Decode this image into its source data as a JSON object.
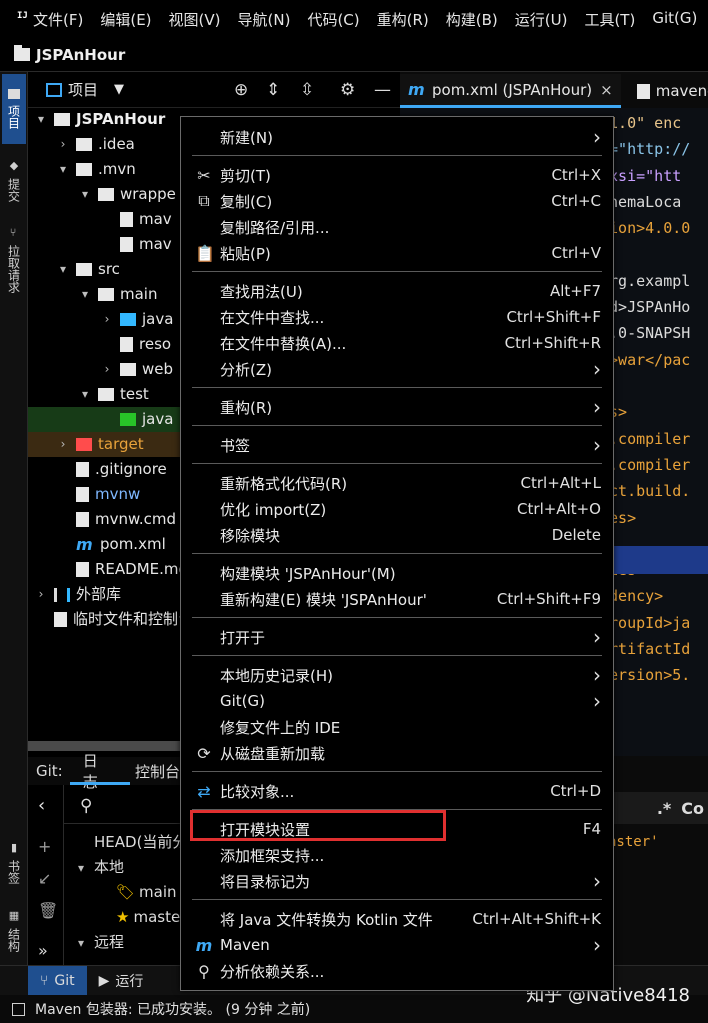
{
  "menubar": {
    "items": [
      "文件(F)",
      "编辑(E)",
      "视图(V)",
      "导航(N)",
      "代码(C)",
      "重构(R)",
      "构建(B)",
      "运行(U)",
      "工具(T)",
      "Git(G)",
      "窗"
    ]
  },
  "titlebar": {
    "project": "JSPAnHour"
  },
  "left_stripe": {
    "tabs": [
      "项目",
      "提交",
      "拉取请求",
      "书签",
      "结构"
    ]
  },
  "project_panel": {
    "title": "项目",
    "tree": [
      {
        "label": "JSPAnHour",
        "depth": 0,
        "arrow": "▾",
        "icon": "project",
        "color": "#f0f0f0",
        "bold": true
      },
      {
        "label": ".idea",
        "depth": 1,
        "arrow": "›",
        "icon": "folder",
        "color": "#e6e6e6"
      },
      {
        "label": ".mvn",
        "depth": 1,
        "arrow": "▾",
        "icon": "folder",
        "color": "#e6e6e6"
      },
      {
        "label": "wrappe",
        "depth": 2,
        "arrow": "▾",
        "icon": "folder",
        "color": "#e6e6e6"
      },
      {
        "label": "mav",
        "depth": 3,
        "arrow": "",
        "icon": "file",
        "color": "#e6e6e6"
      },
      {
        "label": "mav",
        "depth": 3,
        "arrow": "",
        "icon": "file",
        "color": "#e6e6e6"
      },
      {
        "label": "src",
        "depth": 1,
        "arrow": "▾",
        "icon": "folder",
        "color": "#e6e6e6"
      },
      {
        "label": "main",
        "depth": 2,
        "arrow": "▾",
        "icon": "folder",
        "color": "#e6e6e6"
      },
      {
        "label": "java",
        "depth": 3,
        "arrow": "›",
        "icon": "folder-blue",
        "color": "#e6e6e6"
      },
      {
        "label": "reso",
        "depth": 3,
        "arrow": "",
        "icon": "file",
        "color": "#e6e6e6"
      },
      {
        "label": "web",
        "depth": 3,
        "arrow": "›",
        "icon": "folder",
        "color": "#e6e6e6"
      },
      {
        "label": "test",
        "depth": 2,
        "arrow": "▾",
        "icon": "folder",
        "color": "#e6e6e6"
      },
      {
        "label": "java",
        "depth": 3,
        "arrow": "",
        "icon": "folder-green",
        "color": "#e6e6e6",
        "hl": "green"
      },
      {
        "label": "target",
        "depth": 1,
        "arrow": "›",
        "icon": "folder-red",
        "color": "#e8a23a",
        "hl": "brown"
      },
      {
        "label": ".gitignore",
        "depth": 1,
        "arrow": "",
        "icon": "file",
        "color": "#e6e6e6"
      },
      {
        "label": "mvnw",
        "depth": 1,
        "arrow": "",
        "icon": "file",
        "color": "#7fb8ff"
      },
      {
        "label": "mvnw.cmd",
        "depth": 1,
        "arrow": "",
        "icon": "file",
        "color": "#e6e6e6"
      },
      {
        "label": "pom.xml",
        "depth": 1,
        "arrow": "",
        "icon": "m",
        "color": "#e6e6e6"
      },
      {
        "label": "README.md",
        "depth": 1,
        "arrow": "",
        "icon": "file",
        "color": "#e6e6e6"
      },
      {
        "label": "外部库",
        "depth": 0,
        "arrow": "›",
        "icon": "lib",
        "color": "#e6e6e6"
      },
      {
        "label": "临时文件和控制台",
        "depth": 0,
        "arrow": "",
        "icon": "file",
        "color": "#e6e6e6"
      }
    ]
  },
  "git_panel": {
    "label": "Git:",
    "tabs": [
      "日志",
      "控制台"
    ],
    "rows": [
      {
        "label": "HEAD(当前分支)",
        "depth": 0,
        "arrow": ""
      },
      {
        "label": "本地",
        "depth": 0,
        "arrow": "▾"
      },
      {
        "label": "main",
        "depth": 1,
        "arrow": "",
        "icon": "🏷"
      },
      {
        "label": "master",
        "depth": 1,
        "arrow": "",
        "icon": "★"
      },
      {
        "label": "远程",
        "depth": 0,
        "arrow": "▾"
      }
    ]
  },
  "bottom_stripe": {
    "tabs": [
      "Git",
      "运行"
    ]
  },
  "statusbar": {
    "text": "Maven 包装器: 已成功安装。 (9 分钟 之前)",
    "watermark": "知乎 @Native8418"
  },
  "editor": {
    "tabs": [
      {
        "label": "pom.xml (JSPAnHour)",
        "close": "×"
      },
      {
        "label": "maven-"
      }
    ],
    "lines": [
      "'1.0\" enc",
      "s=\"http://",
      ":xsi=\"htt",
      "chemaLoca",
      "sion>4.0.0",
      "",
      "org.exampl",
      "Id>JSPAnHo",
      "1.0-SNAPSH",
      "g>war</pac",
      "",
      "es>",
      "n.compiler",
      "n.compiler",
      "ect.build.",
      "ies>",
      "",
      "cies>",
      "ndency>",
      "groupId>ja",
      "artifactId",
      "version>5."
    ],
    "bottom_text": "aster'",
    "bottom_text2": "ncies",
    "find_label": "Co"
  },
  "context_menu": {
    "groups": [
      [
        {
          "label": "新建(N)",
          "submenu": true
        }
      ],
      [
        {
          "icon": "✂",
          "label": "剪切(T)",
          "shortcut": "Ctrl+X"
        },
        {
          "icon": "⧉",
          "label": "复制(C)",
          "shortcut": "Ctrl+C"
        },
        {
          "label": "复制路径/引用..."
        },
        {
          "icon": "📋",
          "label": "粘贴(P)",
          "shortcut": "Ctrl+V"
        }
      ],
      [
        {
          "label": "查找用法(U)",
          "shortcut": "Alt+F7"
        },
        {
          "label": "在文件中查找...",
          "shortcut": "Ctrl+Shift+F"
        },
        {
          "label": "在文件中替换(A)...",
          "shortcut": "Ctrl+Shift+R"
        },
        {
          "label": "分析(Z)",
          "submenu": true
        }
      ],
      [
        {
          "label": "重构(R)",
          "submenu": true
        }
      ],
      [
        {
          "label": "书签",
          "submenu": true
        }
      ],
      [
        {
          "label": "重新格式化代码(R)",
          "shortcut": "Ctrl+Alt+L"
        },
        {
          "label": "优化 import(Z)",
          "shortcut": "Ctrl+Alt+O"
        },
        {
          "label": "移除模块",
          "shortcut": "Delete"
        }
      ],
      [
        {
          "label": "构建模块 'JSPAnHour'(M)"
        },
        {
          "label": "重新构建(E) 模块 'JSPAnHour'",
          "shortcut": "Ctrl+Shift+F9"
        }
      ],
      [
        {
          "label": "打开于",
          "submenu": true
        }
      ],
      [
        {
          "label": "本地历史记录(H)",
          "submenu": true
        },
        {
          "label": "Git(G)",
          "submenu": true
        },
        {
          "label": "修复文件上的 IDE"
        },
        {
          "icon": "⟳",
          "label": "从磁盘重新加载"
        }
      ],
      [
        {
          "icon": "⇄",
          "label": "比较对象...",
          "shortcut": "Ctrl+D"
        }
      ],
      [
        {
          "label": "打开模块设置",
          "shortcut": "F4",
          "highlighted": true
        },
        {
          "label": "添加框架支持..."
        },
        {
          "label": "将目录标记为",
          "submenu": true
        }
      ],
      [
        {
          "label": "将 Java 文件转换为 Kotlin 文件",
          "shortcut": "Ctrl+Alt+Shift+K"
        },
        {
          "icon": "m",
          "label": "Maven",
          "submenu": true
        },
        {
          "icon": "⚲",
          "label": "分析依赖关系..."
        }
      ]
    ]
  },
  "colors": {
    "accent": "#3fa9f5",
    "highlight_box": "#e03030",
    "menu_bg": "#000000"
  }
}
